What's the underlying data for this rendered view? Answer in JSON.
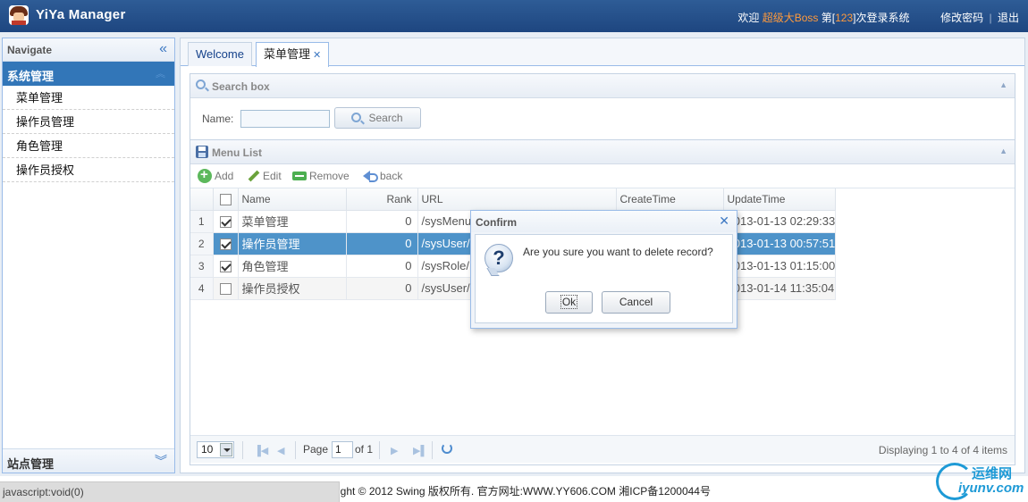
{
  "header": {
    "app_title": "YiYa Manager",
    "welcome_prefix": "欢迎",
    "user_name": "超级大Boss",
    "login_count_prefix": "第[",
    "login_count": "123",
    "login_count_suffix": "]次登录系统",
    "change_password": "修改密码",
    "separator": "|",
    "logout": "退出"
  },
  "sidebar": {
    "title": "Navigate",
    "group": "系统管理",
    "items": [
      {
        "label": "菜单管理"
      },
      {
        "label": "操作员管理"
      },
      {
        "label": "角色管理"
      },
      {
        "label": "操作员授权"
      }
    ],
    "footer_group": "站点管理"
  },
  "tabs": [
    {
      "label": "Welcome"
    },
    {
      "label": "菜单管理"
    }
  ],
  "search_panel": {
    "title": "Search box",
    "name_label": "Name:",
    "name_value": "",
    "search_button": "Search"
  },
  "list_panel": {
    "title": "Menu List",
    "toolbar": {
      "add": "Add",
      "edit": "Edit",
      "remove": "Remove",
      "back": "back"
    },
    "columns": {
      "name": "Name",
      "rank": "Rank",
      "url": "URL",
      "create_time": "CreateTime",
      "update_time": "UpdateTime"
    },
    "rows": [
      {
        "num": "1",
        "checked": true,
        "name": "菜单管理",
        "rank": "0",
        "url": "/sysMenu",
        "update_time": "2013-01-13 02:29:33",
        "selected": false
      },
      {
        "num": "2",
        "checked": true,
        "name": "操作员管理",
        "rank": "0",
        "url": "/sysUser/",
        "update_time": "2013-01-13 00:57:51",
        "selected": true
      },
      {
        "num": "3",
        "checked": true,
        "name": "角色管理",
        "rank": "0",
        "url": "/sysRole/",
        "update_time": "2013-01-13 01:15:00",
        "selected": false
      },
      {
        "num": "4",
        "checked": false,
        "name": "操作员授权",
        "rank": "0",
        "url": "/sysUser/",
        "update_time": "2013-01-14 11:35:04",
        "selected": false
      }
    ],
    "pager": {
      "page_size": "10",
      "page_label": "Page",
      "page_value": "1",
      "of_label": "of 1",
      "display_text": "Displaying 1 to 4 of 4 items"
    }
  },
  "dialog": {
    "title": "Confirm",
    "message": "Are you sure you want to delete record?",
    "ok": "Ok",
    "cancel": "Cancel"
  },
  "footer": {
    "copyright": "ight © 2012 Swing 版权所有.  官方网址:WWW.YY606.COM   湘ICP备1200044号"
  },
  "status_bar": "javascript:void(0)",
  "watermark": {
    "top": "运维网",
    "bottom": "iyunv.com"
  },
  "colors": {
    "header": "#2e5c96",
    "accent": "#3276b8",
    "selected_row": "#4e93c9",
    "highlight": "#ff9a3c"
  }
}
